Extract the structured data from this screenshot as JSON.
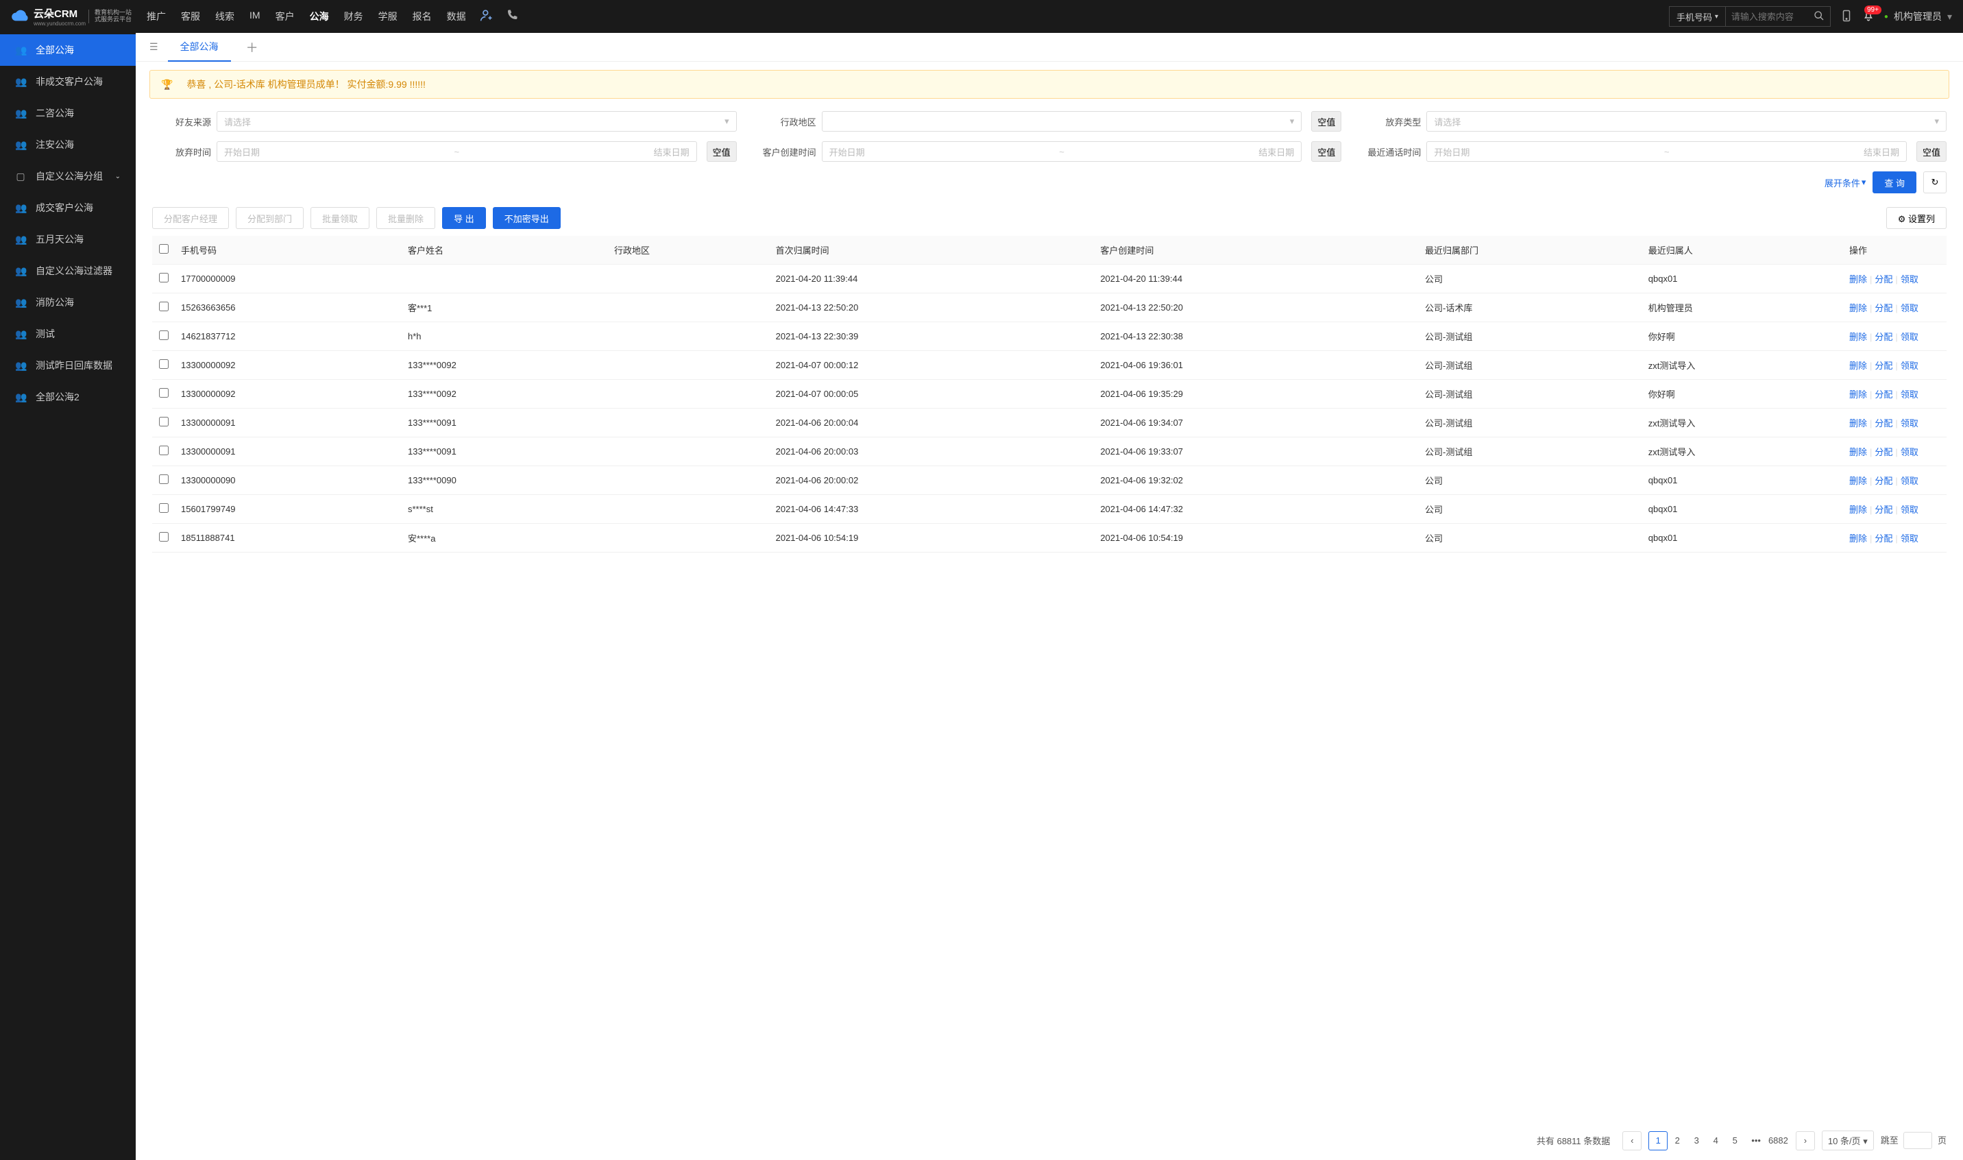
{
  "header": {
    "logo_main": "云朵CRM",
    "logo_sub1": "教育机构一站",
    "logo_sub2": "式服务云平台",
    "logo_url": "www.yunduocrm.com",
    "nav": [
      "推广",
      "客服",
      "线索",
      "IM",
      "客户",
      "公海",
      "财务",
      "学服",
      "报名",
      "数据"
    ],
    "nav_active": "公海",
    "search_type": "手机号码",
    "search_placeholder": "请输入搜索内容",
    "badge": "99+",
    "admin": "机构管理员"
  },
  "sidebar": {
    "items": [
      {
        "label": "全部公海",
        "icon": "👥",
        "active": true
      },
      {
        "label": "非成交客户公海",
        "icon": "👥"
      },
      {
        "label": "二咨公海",
        "icon": "👥"
      },
      {
        "label": "注安公海",
        "icon": "👥"
      },
      {
        "label": "自定义公海分组",
        "icon": "▢",
        "chev": true
      },
      {
        "label": "成交客户公海",
        "icon": "👥"
      },
      {
        "label": "五月天公海",
        "icon": "👥"
      },
      {
        "label": "自定义公海过滤器",
        "icon": "👥"
      },
      {
        "label": "消防公海",
        "icon": "👥"
      },
      {
        "label": "测试",
        "icon": "👥"
      },
      {
        "label": "测试昨日回库数据",
        "icon": "👥"
      },
      {
        "label": "全部公海2",
        "icon": "👥"
      }
    ]
  },
  "tab": {
    "label": "全部公海"
  },
  "alert": {
    "text": "恭喜 , 公司-话术库  机构管理员成单！  实付金额:9.99 !!!!!!"
  },
  "filters": {
    "source_label": "好友来源",
    "source_ph": "请选择",
    "region_label": "行政地区",
    "region_ph": "",
    "abandon_type_label": "放弃类型",
    "abandon_type_ph": "请选择",
    "abandon_time_label": "放弃时间",
    "create_time_label": "客户创建时间",
    "last_call_label": "最近通话时间",
    "date_start": "开始日期",
    "date_end": "结束日期",
    "null_btn": "空值",
    "expand": "展开条件",
    "query": "查 询"
  },
  "actions": {
    "assign_mgr": "分配客户经理",
    "assign_dept": "分配到部门",
    "batch_take": "批量领取",
    "batch_del": "批量删除",
    "export": "导 出",
    "export_plain": "不加密导出",
    "set_cols": "设置列"
  },
  "columns": [
    "手机号码",
    "客户姓名",
    "行政地区",
    "首次归属时间",
    "客户创建时间",
    "最近归属部门",
    "最近归属人",
    "操作"
  ],
  "ops": {
    "del": "删除",
    "assign": "分配",
    "take": "领取"
  },
  "rows": [
    {
      "phone": "17700000009",
      "name": "",
      "region": "",
      "first": "2021-04-20 11:39:44",
      "created": "2021-04-20 11:39:44",
      "dept": "公司",
      "owner": "qbqx01"
    },
    {
      "phone": "15263663656",
      "name": "客***1",
      "region": "",
      "first": "2021-04-13 22:50:20",
      "created": "2021-04-13 22:50:20",
      "dept": "公司-话术库",
      "owner": "机构管理员"
    },
    {
      "phone": "14621837712",
      "name": "h*h",
      "region": "",
      "first": "2021-04-13 22:30:39",
      "created": "2021-04-13 22:30:38",
      "dept": "公司-测试组",
      "owner": "你好啊"
    },
    {
      "phone": "13300000092",
      "name": "133****0092",
      "region": "",
      "first": "2021-04-07 00:00:12",
      "created": "2021-04-06 19:36:01",
      "dept": "公司-测试组",
      "owner": "zxt测试导入"
    },
    {
      "phone": "13300000092",
      "name": "133****0092",
      "region": "",
      "first": "2021-04-07 00:00:05",
      "created": "2021-04-06 19:35:29",
      "dept": "公司-测试组",
      "owner": "你好啊"
    },
    {
      "phone": "13300000091",
      "name": "133****0091",
      "region": "",
      "first": "2021-04-06 20:00:04",
      "created": "2021-04-06 19:34:07",
      "dept": "公司-测试组",
      "owner": "zxt测试导入"
    },
    {
      "phone": "13300000091",
      "name": "133****0091",
      "region": "",
      "first": "2021-04-06 20:00:03",
      "created": "2021-04-06 19:33:07",
      "dept": "公司-测试组",
      "owner": "zxt测试导入"
    },
    {
      "phone": "13300000090",
      "name": "133****0090",
      "region": "",
      "first": "2021-04-06 20:00:02",
      "created": "2021-04-06 19:32:02",
      "dept": "公司",
      "owner": "qbqx01"
    },
    {
      "phone": "15601799749",
      "name": "s****st",
      "region": "",
      "first": "2021-04-06 14:47:33",
      "created": "2021-04-06 14:47:32",
      "dept": "公司",
      "owner": "qbqx01"
    },
    {
      "phone": "18511888741",
      "name": "安****a",
      "region": "",
      "first": "2021-04-06 10:54:19",
      "created": "2021-04-06 10:54:19",
      "dept": "公司",
      "owner": "qbqx01"
    }
  ],
  "pager": {
    "total_prefix": "共有",
    "total": "68811",
    "total_suffix": "条数据",
    "pages": [
      "1",
      "2",
      "3",
      "4",
      "5"
    ],
    "last": "6882",
    "per": "10 条/页",
    "jump_prefix": "跳至",
    "jump_suffix": "页"
  }
}
